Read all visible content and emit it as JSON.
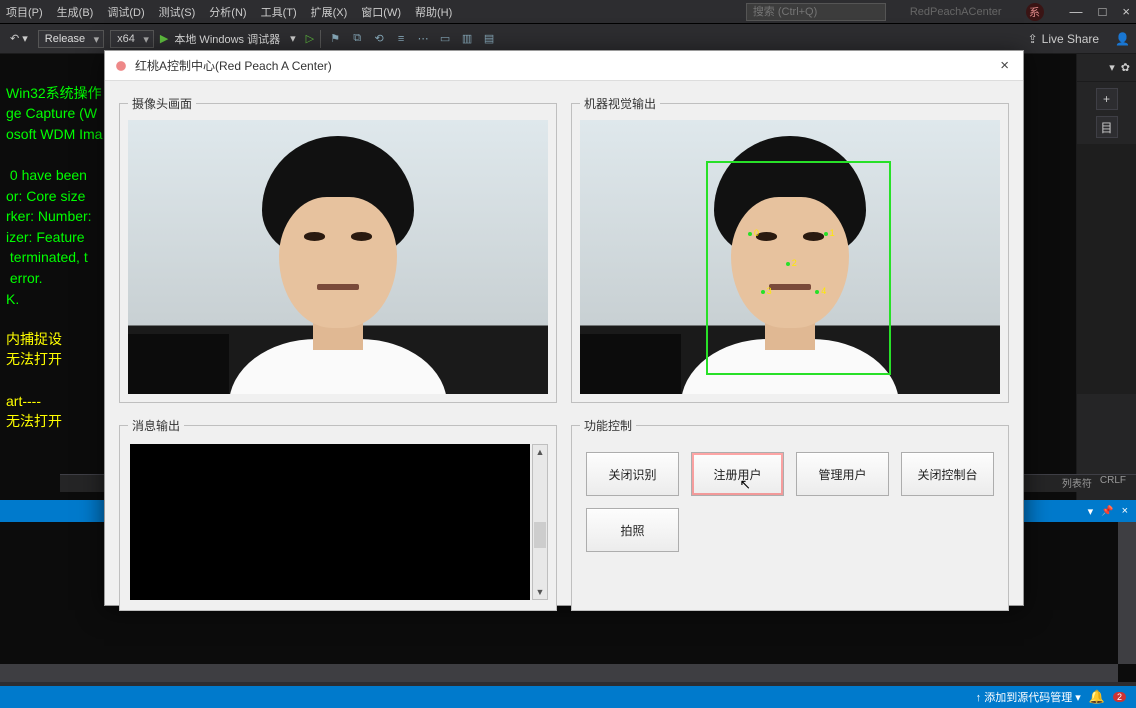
{
  "menubar": {
    "items": [
      "项目(P)",
      "生成(B)",
      "调试(D)",
      "测试(S)",
      "分析(N)",
      "工具(T)",
      "扩展(X)",
      "窗口(W)",
      "帮助(H)"
    ],
    "search_placeholder": "搜索 (Ctrl+Q)",
    "project_title": "RedPeachACenter"
  },
  "toolbar": {
    "config": "Release",
    "platform": "x64",
    "run_label": "本地 Windows 调试器",
    "liveshare": "Live Share"
  },
  "console_lines": [
    "Win32系统操作",
    "ge Capture (W",
    "osoft WDM Ima",
    "",
    " 0 have been ",
    "or: Core size",
    "rker: Number:",
    "izer: Feature",
    " terminated, t",
    " error.",
    "K."
  ],
  "console_yellow": [
    "内捕捉设",
    "无法打开",
    "",
    "art----",
    "无法打开"
  ],
  "list_headers": [
    "列表符",
    "CRLF"
  ],
  "dock": {
    "title": "",
    "pin": "📌",
    "close": "×"
  },
  "statusbar": {
    "scm": "↑ 添加到源代码管理 ▾",
    "bell": "🔔",
    "badge": "2"
  },
  "dialog": {
    "title": "红桃A控制中心(Red Peach A Center)",
    "group_camera": "摄像头画面",
    "group_vision": "机器视觉输出",
    "group_msg": "消息输出",
    "group_ctrl": "功能控制",
    "buttons": {
      "toggle_recog": "关闭识别",
      "register_user": "注册用户",
      "manage_user": "管理用户",
      "close_console": "关闭控制台",
      "photo": "拍照"
    },
    "landmarks": [
      "0",
      "1",
      "2",
      "3",
      "4"
    ]
  }
}
